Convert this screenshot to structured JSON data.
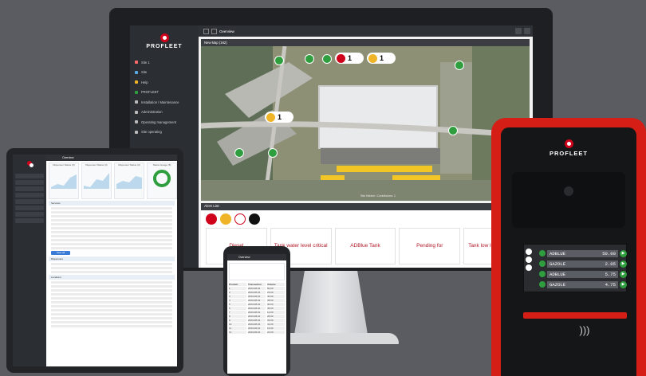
{
  "brand": "PROFLEET",
  "colors": {
    "accent": "#d0021b",
    "ok": "#2e9e3e",
    "warn": "#f0b429",
    "dark": "#2b2e32"
  },
  "monitor": {
    "title": "Overview",
    "sidebar": [
      {
        "label": "Site 1",
        "color": "#ff6b6b"
      },
      {
        "label": "Site",
        "color": "#5aa9e6"
      },
      {
        "label": "Help",
        "color": "#f0b429"
      },
      {
        "label": "PROFLEET",
        "color": "#2e9e3e"
      },
      {
        "label": "Installation / Maintenance",
        "color": "#bbbbbb"
      },
      {
        "label": "Administration",
        "color": "#bbbbbb"
      },
      {
        "label": "Operating management",
        "color": "#bbbbbb"
      },
      {
        "label": "Site operating",
        "color": "#bbbbbb"
      }
    ],
    "map": {
      "title": "New Map (162)",
      "footer": "Site Hidden / Contributors: 1",
      "badges": [
        "1",
        "1",
        "1"
      ]
    },
    "alerts": {
      "title": "Alert List",
      "count": "5",
      "cards": [
        "Diesel",
        "Tank water level critical",
        "ADBlue Tank",
        "Pending for",
        "Tank low level warning"
      ]
    }
  },
  "tablet": {
    "title": "Overview",
    "sections": [
      "Services",
      "Dispensers",
      "Locations"
    ],
    "gauges": [
      "Dispenser Status (3)",
      "Dispenser Status (3)",
      "Dispenser Status (3)",
      "Status Gauge (5)"
    ],
    "action_label": "View all"
  },
  "phone": {
    "title": "Overview",
    "columns": [
      "Product",
      "Transaction",
      "Volume"
    ],
    "rows": [
      [
        "1",
        "2023-08-01",
        "50.00"
      ],
      [
        "2",
        "2023-08-01",
        "23.00"
      ],
      [
        "3",
        "2023-08-01",
        "40.00"
      ],
      [
        "4",
        "2023-08-01",
        "38.00"
      ],
      [
        "5",
        "2023-08-01",
        "30.00"
      ],
      [
        "6",
        "2023-08-01",
        "45.00"
      ],
      [
        "7",
        "2023-08-01",
        "12.00"
      ],
      [
        "8",
        "2023-08-01",
        "28.00"
      ],
      [
        "9",
        "2023-08-01",
        "33.00"
      ],
      [
        "10",
        "2023-08-01",
        "41.00"
      ],
      [
        "11",
        "2023-08-01",
        "19.00"
      ],
      [
        "12",
        "2023-08-01",
        "22.00"
      ]
    ]
  },
  "terminal": {
    "brand": "PROFLEET",
    "fuels": [
      {
        "name": "ADBLUE",
        "price": "50.00"
      },
      {
        "name": "GAZOLE",
        "price": "2.05"
      },
      {
        "name": "ADBLUE",
        "price": "5.75"
      },
      {
        "name": "GAZOLE",
        "price": "4.75"
      }
    ]
  }
}
